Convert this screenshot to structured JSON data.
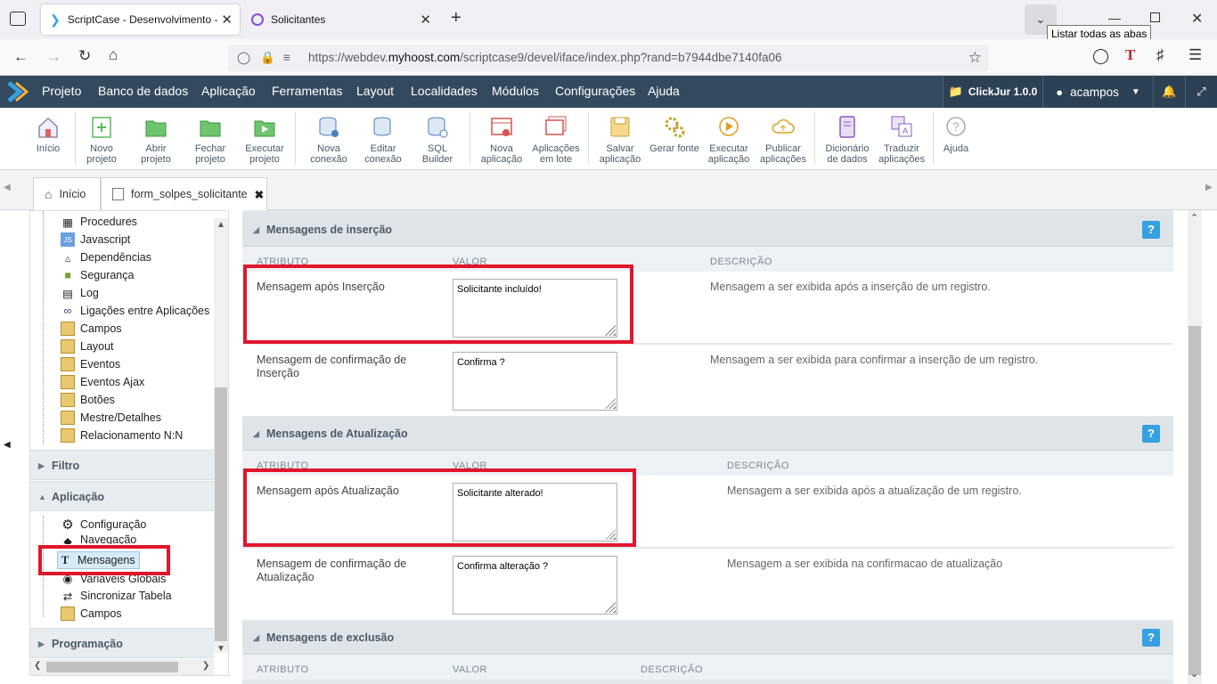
{
  "browser": {
    "tabs": [
      {
        "title": "ScriptCase - Desenvolvimento -",
        "active": true
      },
      {
        "title": "Solicitantes",
        "active": false
      }
    ],
    "url_prefix": "https://webdev.",
    "url_domain": "myhoost.com",
    "url_path": "/scriptcase9/devel/iface/index.php?rand=b7944dbe7140fa06",
    "tooltip": "Listar todas as abas"
  },
  "menubar": {
    "items": [
      "Projeto",
      "Banco de dados",
      "Aplicação",
      "Ferramentas",
      "Layout",
      "Localidades",
      "Módulos",
      "Configurações",
      "Ajuda"
    ],
    "project": "ClickJur 1.0.0",
    "user": "acampos"
  },
  "toolbar": [
    {
      "label": "Início",
      "icon": "home-icon"
    },
    {
      "label": "Novo projeto",
      "icon": "new-project-icon"
    },
    {
      "label": "Abrir projeto",
      "icon": "open-folder-icon"
    },
    {
      "label": "Fechar projeto",
      "icon": "close-folder-icon"
    },
    {
      "label": "Executar projeto",
      "icon": "run-project-icon"
    },
    {
      "label": "Nova conexão",
      "icon": "new-connection-icon"
    },
    {
      "label": "Editar conexão",
      "icon": "edit-connection-icon"
    },
    {
      "label": "SQL Builder",
      "icon": "sql-builder-icon"
    },
    {
      "label": "Nova aplicação",
      "icon": "new-app-icon"
    },
    {
      "label": "Aplicações em lote",
      "icon": "batch-apps-icon"
    },
    {
      "label": "Salvar aplicação",
      "icon": "save-icon"
    },
    {
      "label": "Gerar fonte",
      "icon": "generate-source-icon"
    },
    {
      "label": "Executar aplicação",
      "icon": "run-app-icon"
    },
    {
      "label": "Publicar aplicações",
      "icon": "publish-icon"
    },
    {
      "label": "Dicionário de dados",
      "icon": "dictionary-icon"
    },
    {
      "label": "Traduzir aplicações",
      "icon": "translate-icon"
    },
    {
      "label": "Ajuda",
      "icon": "help-icon"
    }
  ],
  "tabs": {
    "home": "Início",
    "app": "form_solpes_solicitante"
  },
  "tree": {
    "items": [
      "Procedures",
      "Javascript",
      "Dependências",
      "Segurança",
      "Log",
      "Ligações entre Aplicações",
      "Campos",
      "Layout",
      "Eventos",
      "Eventos Ajax",
      "Botões",
      "Mestre/Detalhes",
      "Relacionamento N:N"
    ],
    "sections": {
      "filtro": "Filtro",
      "aplicacao": "Aplicação",
      "programacao": "Programação"
    },
    "app_items": [
      "Configuração",
      "Navegação",
      "Mensagens",
      "Variáveis Globais",
      "Sincronizar Tabela",
      "Campos"
    ]
  },
  "main": {
    "columns": {
      "attr": "ATRIBUTO",
      "value": "VALOR",
      "desc": "DESCRIÇÃO"
    },
    "help": "?",
    "sections": [
      {
        "title": "Mensagens de inserção",
        "rows": [
          {
            "label": "Mensagem após Inserção",
            "value": "Solicitante incluído!",
            "desc": "Mensagem a ser exibida após a inserção de um registro."
          },
          {
            "label": "Mensagem de confirmação de Inserção",
            "value": "Confirma ?",
            "desc": "Mensagem a ser exibida para confirmar a inserção de um registro."
          }
        ]
      },
      {
        "title": "Mensagens de Atualização",
        "rows": [
          {
            "label": "Mensagem após Atualização",
            "value": "Solicitante alterado!",
            "desc": "Mensagem a ser exibida após a atualização de um registro."
          },
          {
            "label": "Mensagem de confirmação de Atualização",
            "value": "Confirma alteração ?",
            "desc": "Mensagem a ser exibida na confirmacao de atualização"
          }
        ]
      },
      {
        "title": "Mensagens de exclusão",
        "rows": []
      }
    ]
  }
}
